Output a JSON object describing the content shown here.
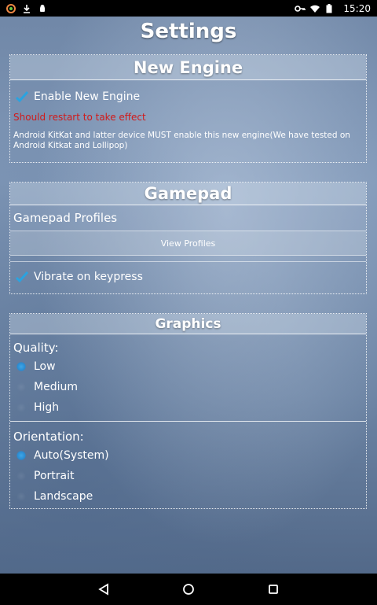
{
  "status_bar": {
    "time": "15:20",
    "left_icons": [
      "app-icon",
      "download-icon",
      "android-icon"
    ],
    "right_icons": [
      "key-icon",
      "wifi-icon",
      "battery-icon"
    ]
  },
  "page": {
    "title": "Settings"
  },
  "new_engine": {
    "header": "New Engine",
    "enable_label": "Enable New Engine",
    "enable_checked": true,
    "warning": "Should restart to take effect",
    "note": "Android KitKat and latter device MUST enable this new engine(We have tested on Android Kitkat and Lollipop)"
  },
  "gamepad": {
    "header": "Gamepad",
    "profiles_label": "Gamepad Profiles",
    "view_profiles_button": "View Profiles",
    "vibrate_label": "Vibrate on keypress",
    "vibrate_checked": true
  },
  "graphics": {
    "header": "Graphics",
    "quality_label": "Quality:",
    "quality_options": [
      "Low",
      "Medium",
      "High"
    ],
    "quality_selected": "Low",
    "orientation_label": "Orientation:",
    "orientation_options": [
      "Auto(System)",
      "Portrait",
      "Landscape"
    ],
    "orientation_selected": "Auto(System)"
  },
  "nav_bar": {
    "icons": [
      "back-icon",
      "home-icon",
      "recents-icon"
    ]
  },
  "colors": {
    "accent": "#2a8ad0",
    "warning": "#d11a1a",
    "check": "#2aa3e0"
  }
}
